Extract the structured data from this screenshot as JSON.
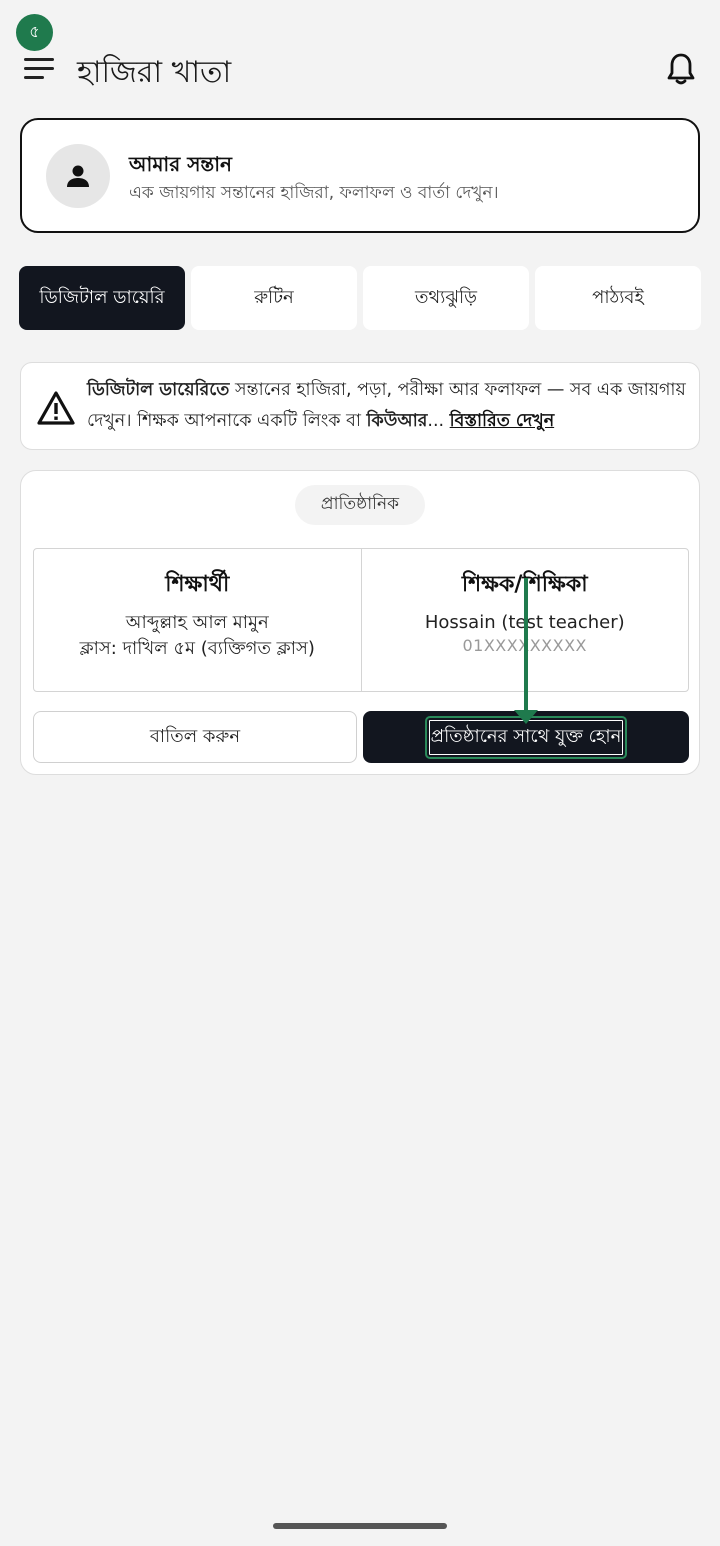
{
  "step_badge": "৫",
  "header": {
    "title": "হাজিরা খাতা"
  },
  "child_card": {
    "title": "আমার সন্তান",
    "subtitle": "এক জায়গায় সন্তানের হাজিরা, ফলাফল ও বার্তা দেখুন।"
  },
  "tabs": [
    {
      "label": "ডিজিটাল ডায়েরি",
      "active": true
    },
    {
      "label": "রুটিন",
      "active": false
    },
    {
      "label": "তথ্যঝুড়ি",
      "active": false
    },
    {
      "label": "পাঠ্যবই",
      "active": false
    }
  ],
  "info": {
    "bold_lead": "ডিজিটাল ডায়েরিতে",
    "text1": " সন্তানের হাজিরা, পড়া, পরীক্ষা আর ফলাফল — সব এক জায়গায় দেখুন। শিক্ষক আপনাকে একটি লিংক বা ",
    "bold_qr": "কিউআর",
    "ellipsis": "... ",
    "link": "বিস্তারিত দেখুন"
  },
  "request": {
    "type_pill": "প্রাতিষ্ঠানিক",
    "student": {
      "heading": "শিক্ষার্থী",
      "name": "আব্দুল্লাহ আল মামুন",
      "class": "ক্লাস: দাখিল ৫ম  (ব্যক্তিগত ক্লাস)"
    },
    "teacher": {
      "heading": "শিক্ষক/শিক্ষিকা",
      "name": "Hossain (test teacher)",
      "phone": "01XXXXXXXXX"
    },
    "cancel_label": "বাতিল করুন",
    "join_label": "প্রতিষ্ঠানের সাথে যুক্ত হোন"
  },
  "colors": {
    "accent_green": "#1f7a4d",
    "primary_dark": "#12161f",
    "background": "#f3f3f3"
  }
}
